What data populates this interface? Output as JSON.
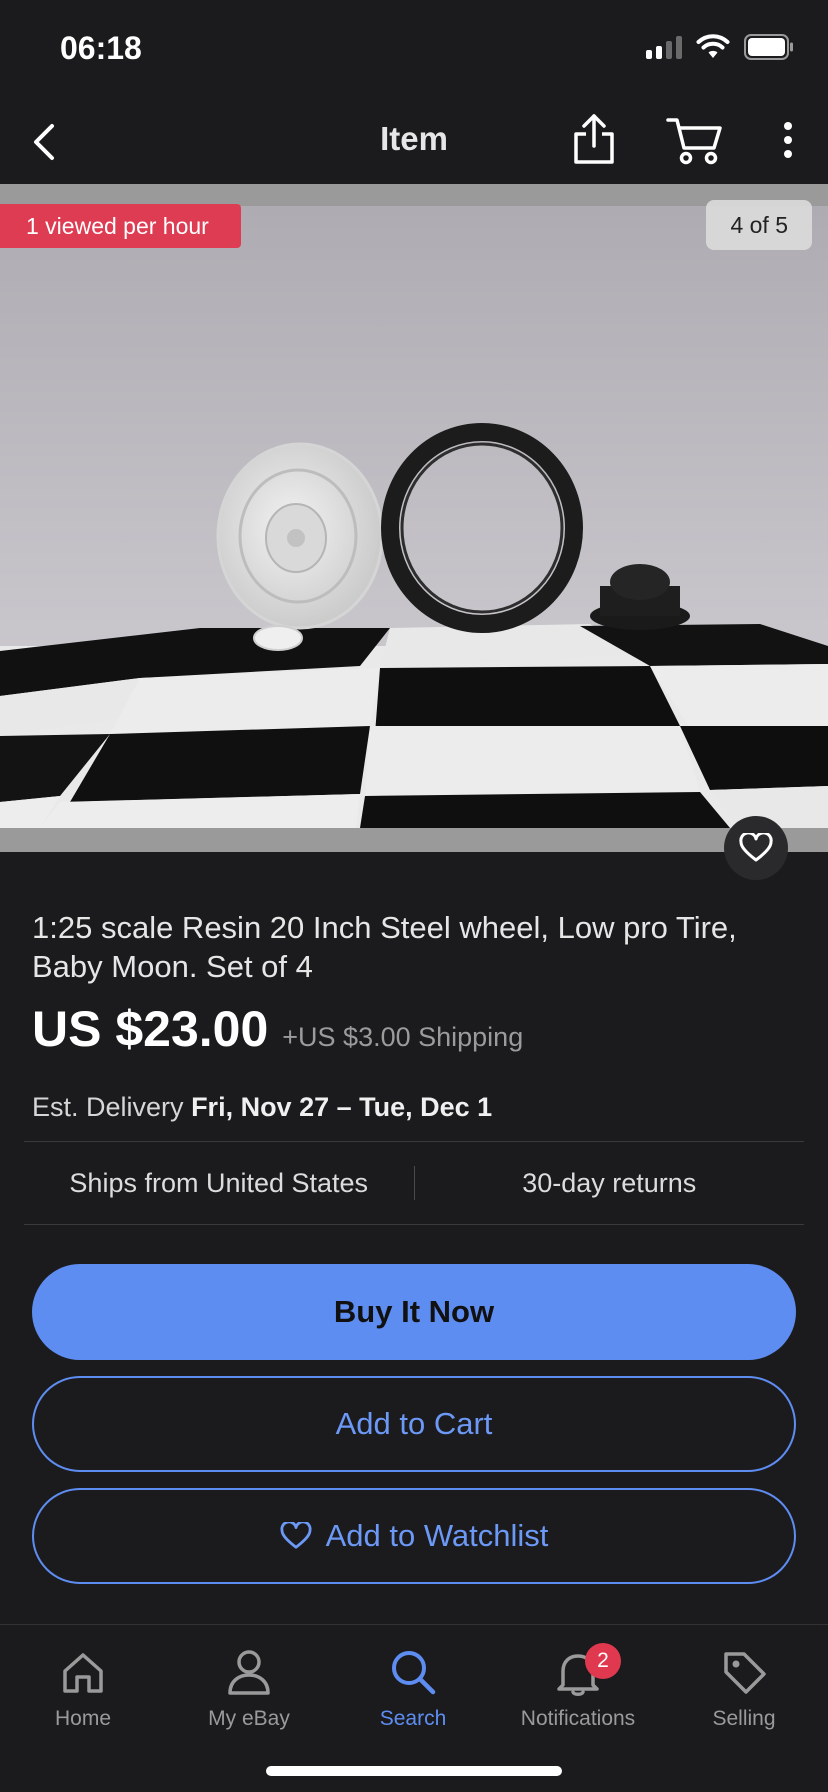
{
  "status_bar": {
    "time": "06:18"
  },
  "nav": {
    "title": "Item",
    "icons": [
      "back-arrow-icon",
      "share-icon",
      "cart-icon",
      "more-vertical-icon"
    ]
  },
  "gallery": {
    "viewed_badge": "1 viewed per hour",
    "counter": "4 of 5"
  },
  "item": {
    "title": "1:25 scale Resin 20 Inch Steel wheel, Low pro Tire, Baby Moon. Set of 4",
    "price": "US $23.00",
    "shipping": "+US $3.00 Shipping",
    "delivery_label": "Est. Delivery",
    "delivery_dates": "Fri, Nov 27 – Tue, Dec 1",
    "ships_from": "Ships from United States",
    "returns": "30-day returns"
  },
  "actions": {
    "buy_now": "Buy It Now",
    "add_to_cart": "Add to Cart",
    "add_to_watchlist": "Add to Watchlist"
  },
  "tab_bar": {
    "items": [
      {
        "label": "Home",
        "icon": "home-icon"
      },
      {
        "label": "My eBay",
        "icon": "person-icon"
      },
      {
        "label": "Search",
        "icon": "search-icon"
      },
      {
        "label": "Notifications",
        "icon": "bell-icon",
        "badge": "2"
      },
      {
        "label": "Selling",
        "icon": "tag-icon"
      }
    ],
    "active": "Search"
  },
  "colors": {
    "background": "#1b1b1d",
    "accent": "#5e8df2",
    "badge_red": "#dd3c52"
  }
}
